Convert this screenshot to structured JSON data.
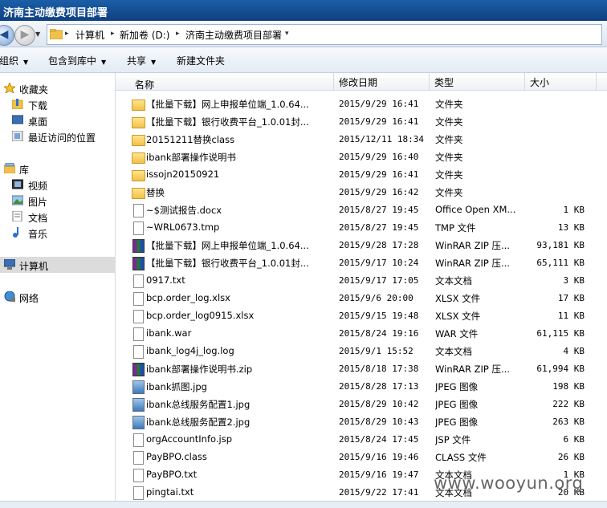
{
  "window": {
    "title": "济南主动缴费项目部署"
  },
  "address": {
    "segments": [
      "计算机",
      "新加卷 (D:)",
      "济南主动缴费项目部署"
    ]
  },
  "toolbar": {
    "organize": "组织",
    "include_library": "包含到库中",
    "share": "共享",
    "new_folder": "新建文件夹"
  },
  "nav": {
    "favorites": "收藏夹",
    "downloads": "下载",
    "desktop": "桌面",
    "recent": "最近访问的位置",
    "libraries": "库",
    "videos": "视频",
    "pictures": "图片",
    "documents": "文档",
    "music": "音乐",
    "computer": "计算机",
    "network": "网络"
  },
  "columns": {
    "name": "名称",
    "date": "修改日期",
    "type": "类型",
    "size": "大小"
  },
  "files": [
    {
      "icon": "folder",
      "name": "【批量下载】网上申报单位端_1.0.64...",
      "date": "2015/9/29 16:41",
      "type": "文件夹",
      "size": ""
    },
    {
      "icon": "folder",
      "name": "【批量下载】银行收费平台_1.0.01封...",
      "date": "2015/9/29 16:41",
      "type": "文件夹",
      "size": ""
    },
    {
      "icon": "folder",
      "name": "20151211替换class",
      "date": "2015/12/11 18:34",
      "type": "文件夹",
      "size": ""
    },
    {
      "icon": "folder",
      "name": "ibank部署操作说明书",
      "date": "2015/9/29 16:40",
      "type": "文件夹",
      "size": ""
    },
    {
      "icon": "folder",
      "name": "issojn20150921",
      "date": "2015/9/29 16:41",
      "type": "文件夹",
      "size": ""
    },
    {
      "icon": "folder",
      "name": "替换",
      "date": "2015/9/29 16:42",
      "type": "文件夹",
      "size": ""
    },
    {
      "icon": "doc",
      "name": "~$测试报告.docx",
      "date": "2015/8/27 19:45",
      "type": "Office Open XM...",
      "size": "1 KB"
    },
    {
      "icon": "doc",
      "name": "~WRL0673.tmp",
      "date": "2015/8/27 19:45",
      "type": "TMP 文件",
      "size": "13 KB"
    },
    {
      "icon": "rar",
      "name": "【批量下载】网上申报单位端_1.0.64...",
      "date": "2015/9/28 17:28",
      "type": "WinRAR ZIP 压...",
      "size": "93,181 KB"
    },
    {
      "icon": "rar",
      "name": "【批量下载】银行收费平台_1.0.01封...",
      "date": "2015/9/17 10:24",
      "type": "WinRAR ZIP 压...",
      "size": "65,111 KB"
    },
    {
      "icon": "doc",
      "name": "0917.txt",
      "date": "2015/9/17 17:05",
      "type": "文本文档",
      "size": "3 KB"
    },
    {
      "icon": "doc",
      "name": "bcp.order_log.xlsx",
      "date": "2015/9/6 20:00",
      "type": "XLSX 文件",
      "size": "17 KB"
    },
    {
      "icon": "doc",
      "name": "bcp.order_log0915.xlsx",
      "date": "2015/9/15 19:48",
      "type": "XLSX 文件",
      "size": "11 KB"
    },
    {
      "icon": "doc",
      "name": "ibank.war",
      "date": "2015/8/24 19:16",
      "type": "WAR 文件",
      "size": "61,115 KB"
    },
    {
      "icon": "doc",
      "name": "ibank_log4j_log.log",
      "date": "2015/9/1 15:52",
      "type": "文本文档",
      "size": "4 KB"
    },
    {
      "icon": "rar",
      "name": "ibank部署操作说明书.zip",
      "date": "2015/8/18 17:38",
      "type": "WinRAR ZIP 压...",
      "size": "61,994 KB"
    },
    {
      "icon": "img",
      "name": "ibank抓图.jpg",
      "date": "2015/8/28 17:13",
      "type": "JPEG 图像",
      "size": "198 KB"
    },
    {
      "icon": "img",
      "name": "ibank总线服务配置1.jpg",
      "date": "2015/8/29 10:42",
      "type": "JPEG 图像",
      "size": "222 KB"
    },
    {
      "icon": "img",
      "name": "ibank总线服务配置2.jpg",
      "date": "2015/8/29 10:43",
      "type": "JPEG 图像",
      "size": "263 KB"
    },
    {
      "icon": "doc",
      "name": "orgAccountInfo.jsp",
      "date": "2015/8/24 17:45",
      "type": "JSP 文件",
      "size": "6 KB"
    },
    {
      "icon": "doc",
      "name": "PayBPO.class",
      "date": "2015/9/16 19:46",
      "type": "CLASS 文件",
      "size": "26 KB"
    },
    {
      "icon": "doc",
      "name": "PayBPO.txt",
      "date": "2015/9/16 19:47",
      "type": "文本文档",
      "size": "1 KB"
    },
    {
      "icon": "doc",
      "name": "pingtai.txt",
      "date": "2015/9/22 17:41",
      "type": "文本文档",
      "size": "20 KB"
    }
  ],
  "watermark": "www.wooyun.org"
}
